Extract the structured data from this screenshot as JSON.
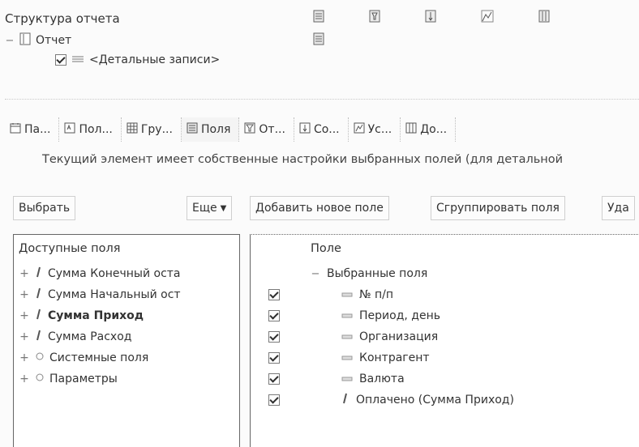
{
  "structure": {
    "title": "Структура отчета",
    "tree": [
      {
        "label": "Отчет"
      },
      {
        "label": "<Детальные записи>"
      }
    ]
  },
  "tabs": [
    {
      "label": "Па...",
      "icon": "calendar-icon"
    },
    {
      "label": "Пол...",
      "icon": "params-icon"
    },
    {
      "label": "Гру...",
      "icon": "grid-icon"
    },
    {
      "label": "Поля",
      "icon": "fields-icon",
      "active": true
    },
    {
      "label": "От...",
      "icon": "filter-icon"
    },
    {
      "label": "Со...",
      "icon": "sort-icon"
    },
    {
      "label": "Ус...",
      "icon": "conditional-format-icon"
    },
    {
      "label": "До...",
      "icon": "extra-fields-icon"
    }
  ],
  "info_text": "Текущий элемент имеет собственные настройки выбранных полей (для детальной",
  "buttons": {
    "select": "Выбрать",
    "more": "Еще",
    "add_field": "Добавить новое поле",
    "group_fields": "Сгруппировать поля",
    "delete": "Уда"
  },
  "available": {
    "header": "Доступные поля",
    "items": [
      {
        "label": "Сумма Конечный оста",
        "icon": "number-field-icon",
        "bold": false
      },
      {
        "label": "Сумма Начальный ост",
        "icon": "number-field-icon",
        "bold": false
      },
      {
        "label": "Сумма Приход",
        "icon": "number-field-icon",
        "bold": true
      },
      {
        "label": "Сумма Расход",
        "icon": "number-field-icon",
        "bold": false
      },
      {
        "label": "Системные поля",
        "icon": "folder-icon",
        "bold": false
      },
      {
        "label": "Параметры",
        "icon": "folder-icon",
        "bold": false
      }
    ]
  },
  "selected": {
    "header": "Поле",
    "group_label": "Выбранные поля",
    "items": [
      {
        "label": "№ п/п",
        "checked": true
      },
      {
        "label": "Период, день",
        "checked": true
      },
      {
        "label": "Организация",
        "checked": true
      },
      {
        "label": "Контрагент",
        "checked": true
      },
      {
        "label": "Валюта",
        "checked": true
      },
      {
        "label": "Оплачено (Сумма Приход)",
        "checked": true
      }
    ]
  }
}
